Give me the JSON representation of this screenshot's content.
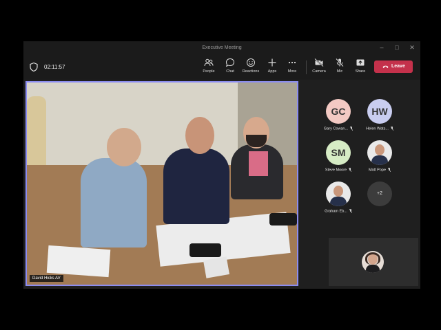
{
  "window": {
    "title": "Executive Meeting"
  },
  "toolbar": {
    "timer": "02:11:57",
    "people_label": "People",
    "chat_label": "Chat",
    "reactions_label": "Reactions",
    "apps_label": "Apps",
    "more_label": "More",
    "camera_label": "Camera",
    "mic_label": "Mic",
    "share_label": "Share",
    "leave_label": "Leave"
  },
  "stage": {
    "speaker_name": "David Hicks AV"
  },
  "participants": [
    {
      "initials": "GC",
      "name": "Gary Cowan...",
      "avatar_color": "#f3c9c3",
      "muted": true
    },
    {
      "initials": "HW",
      "name": "Helen Wats...",
      "avatar_color": "#c9cdf0",
      "muted": true
    },
    {
      "initials": "SM",
      "name": "Steve Moore",
      "avatar_color": "#d6ecc5",
      "muted": true
    },
    {
      "initials": "",
      "name": "Matt Pope",
      "photo": true,
      "muted": true
    },
    {
      "initials": "",
      "name": "Graham Eb...",
      "photo": true,
      "muted": true
    },
    {
      "initials": "+2",
      "name": "",
      "overflow": true
    }
  ],
  "colors": {
    "accent": "#8b8cf0",
    "leave": "#c4314b",
    "background": "#1f1f1f"
  }
}
